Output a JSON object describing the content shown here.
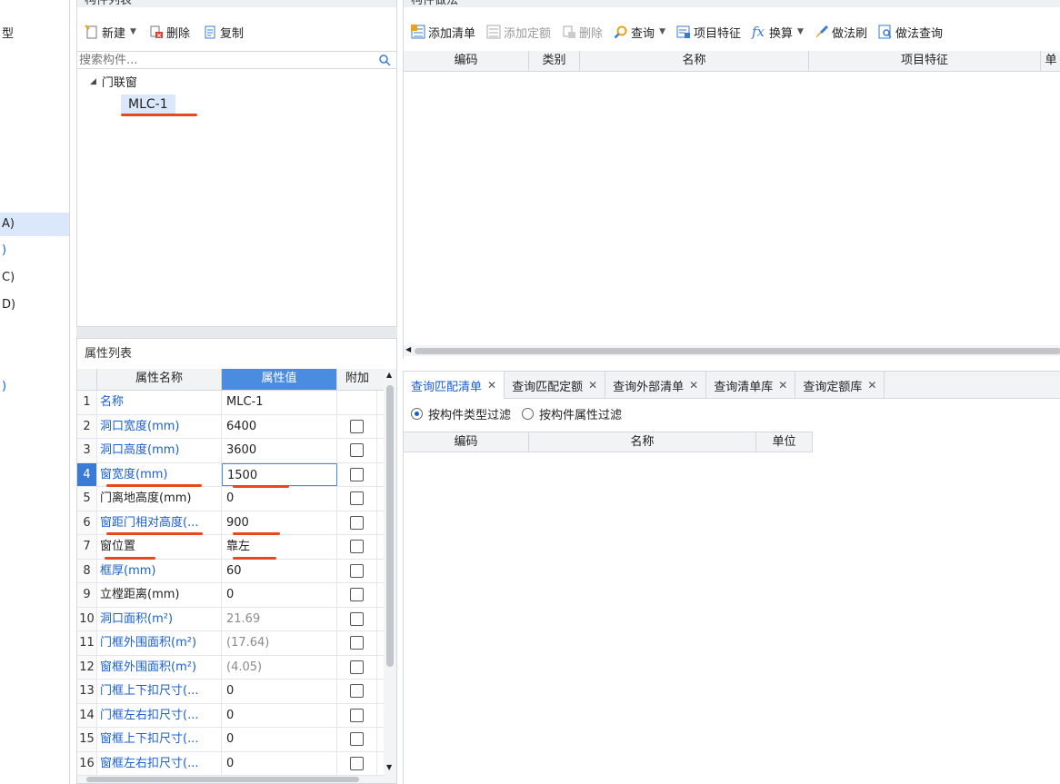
{
  "left_strip": {
    "items": [
      "型",
      "A)",
      ")",
      "C)",
      "D)",
      ")"
    ]
  },
  "component_list": {
    "title": "构件列表",
    "toolbar": {
      "new": "新建",
      "delete": "删除",
      "copy": "复制"
    },
    "search_placeholder": "搜索构件...",
    "tree": {
      "group": "门联窗",
      "item": "MLC-1"
    }
  },
  "component_method": {
    "title": "构件做法",
    "toolbar": {
      "add_list": "添加清单",
      "add_quota": "添加定额",
      "delete": "删除",
      "query": "查询",
      "item_feature": "项目特征",
      "convert": "换算",
      "method_brush": "做法刷",
      "method_query": "做法查询"
    },
    "columns": [
      "编码",
      "类别",
      "名称",
      "项目特征",
      "单"
    ]
  },
  "property_list": {
    "title": "属性列表",
    "columns": [
      "属性名称",
      "属性值",
      "附加"
    ],
    "rows": [
      {
        "idx": "1",
        "name": "名称",
        "value": "MLC-1",
        "blue": true,
        "has_check": false
      },
      {
        "idx": "2",
        "name": "洞口宽度(mm)",
        "value": "6400",
        "blue": true,
        "has_check": true
      },
      {
        "idx": "3",
        "name": "洞口高度(mm)",
        "value": "3600",
        "blue": true,
        "has_check": true
      },
      {
        "idx": "4",
        "name": "窗宽度(mm)",
        "value": "1500",
        "blue": true,
        "has_check": true
      },
      {
        "idx": "5",
        "name": "门离地高度(mm)",
        "value": "0",
        "blue": false,
        "has_check": true
      },
      {
        "idx": "6",
        "name": "窗距门相对高度(...",
        "value": "900",
        "blue": true,
        "has_check": true
      },
      {
        "idx": "7",
        "name": "窗位置",
        "value": "靠左",
        "blue": false,
        "has_check": true
      },
      {
        "idx": "8",
        "name": "框厚(mm)",
        "value": "60",
        "blue": true,
        "has_check": true
      },
      {
        "idx": "9",
        "name": "立樘距离(mm)",
        "value": "0",
        "blue": false,
        "has_check": true
      },
      {
        "idx": "10",
        "name": "洞口面积(m²)",
        "value": "21.69",
        "blue": true,
        "gray": true,
        "has_check": true
      },
      {
        "idx": "11",
        "name": "门框外围面积(m²)",
        "value": "(17.64)",
        "blue": true,
        "gray": true,
        "has_check": true
      },
      {
        "idx": "12",
        "name": "窗框外围面积(m²)",
        "value": "(4.05)",
        "blue": true,
        "gray": true,
        "has_check": true
      },
      {
        "idx": "13",
        "name": "门框上下扣尺寸(...",
        "value": "0",
        "blue": true,
        "has_check": true
      },
      {
        "idx": "14",
        "name": "门框左右扣尺寸(...",
        "value": "0",
        "blue": true,
        "has_check": true
      },
      {
        "idx": "15",
        "name": "窗框上下扣尺寸(...",
        "value": "0",
        "blue": true,
        "has_check": true
      },
      {
        "idx": "16",
        "name": "窗框左右扣尺寸(...",
        "value": "0",
        "blue": true,
        "has_check": true
      }
    ]
  },
  "query_tabs": {
    "tabs": [
      "查询匹配清单",
      "查询匹配定额",
      "查询外部清单",
      "查询清单库",
      "查询定额库"
    ],
    "filter": {
      "by_type": "按构件类型过滤",
      "by_attr": "按构件属性过滤"
    },
    "columns": [
      "编码",
      "名称",
      "单位"
    ]
  }
}
